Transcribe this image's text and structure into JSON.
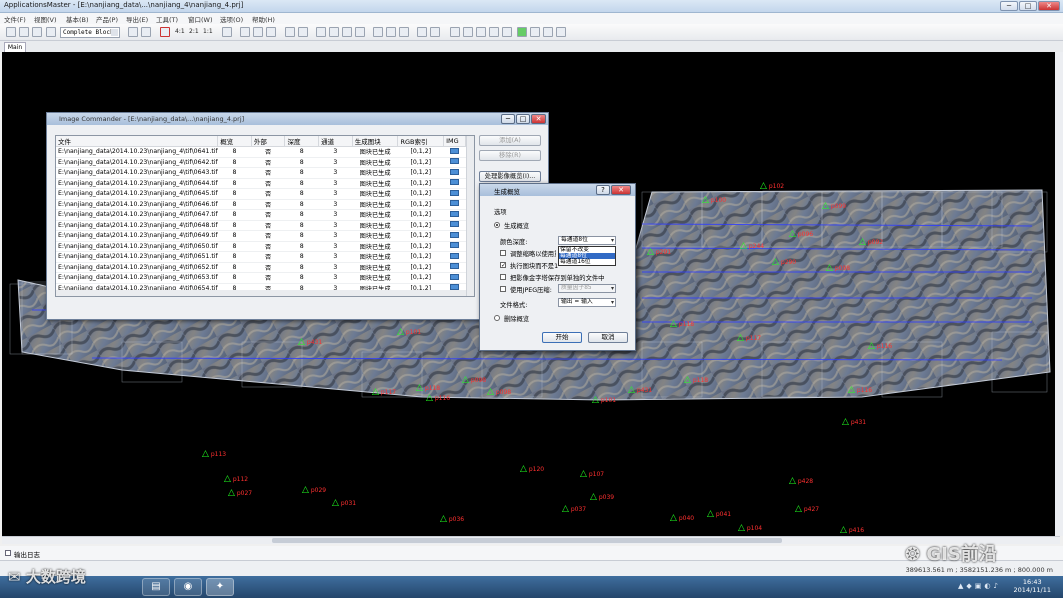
{
  "app": {
    "title": "ApplicationsMaster - [E:\\nanjiang_data\\...\\nanjiang_4\\nanjiang_4.prj]",
    "min_symbol": "─",
    "max_symbol": "□",
    "close_symbol": "✕"
  },
  "menu": [
    "文件(F)",
    "视图(V)",
    "基本(B)",
    "产品(P)",
    "导出(E)",
    "工具(T)",
    "窗口(W)",
    "选项(O)",
    "帮助(H)"
  ],
  "toolbar": {
    "block_combo": "Complete Block",
    "ratio_labels": [
      "4:1",
      "2:1",
      "1:1"
    ]
  },
  "tabs": [
    "Main"
  ],
  "map": {
    "points": [
      "p115",
      "p113",
      "p112",
      "p027",
      "p029",
      "p031",
      "p036",
      "p120",
      "p107",
      "p039",
      "p037",
      "p040",
      "p041",
      "p104",
      "p428",
      "p427",
      "p416",
      "p431",
      "p101",
      "p116",
      "p117",
      "p118",
      "p098",
      "p290",
      "p291",
      "p092",
      "p096",
      "p244",
      "p240",
      "p099",
      "p100",
      "p102"
    ]
  },
  "image_commander": {
    "title": "Image Commander - [E:\\nanjiang_data\\...\\nanjiang_4.prj]",
    "columns": [
      "文件",
      "概览",
      "外部",
      "深度",
      "通道",
      "生成图块",
      "RGB索引",
      "IMG"
    ],
    "rows": [
      [
        "E:\\nanjiang_data\\2014.10.23\\nanjiang_4\\tif\\0641.tif",
        "8",
        "否",
        "8",
        "3",
        "图块已生成",
        "[0,1,2]"
      ],
      [
        "E:\\nanjiang_data\\2014.10.23\\nanjiang_4\\tif\\0642.tif",
        "8",
        "否",
        "8",
        "3",
        "图块已生成",
        "[0,1,2]"
      ],
      [
        "E:\\nanjiang_data\\2014.10.23\\nanjiang_4\\tif\\0643.tif",
        "8",
        "否",
        "8",
        "3",
        "图块已生成",
        "[0,1,2]"
      ],
      [
        "E:\\nanjiang_data\\2014.10.23\\nanjiang_4\\tif\\0644.tif",
        "8",
        "否",
        "8",
        "3",
        "图块已生成",
        "[0,1,2]"
      ],
      [
        "E:\\nanjiang_data\\2014.10.23\\nanjiang_4\\tif\\0645.tif",
        "8",
        "否",
        "8",
        "3",
        "图块已生成",
        "[0,1,2]"
      ],
      [
        "E:\\nanjiang_data\\2014.10.23\\nanjiang_4\\tif\\0646.tif",
        "8",
        "否",
        "8",
        "3",
        "图块已生成",
        "[0,1,2]"
      ],
      [
        "E:\\nanjiang_data\\2014.10.23\\nanjiang_4\\tif\\0647.tif",
        "8",
        "否",
        "8",
        "3",
        "图块已生成",
        "[0,1,2]"
      ],
      [
        "E:\\nanjiang_data\\2014.10.23\\nanjiang_4\\tif\\0648.tif",
        "8",
        "否",
        "8",
        "3",
        "图块已生成",
        "[0,1,2]"
      ],
      [
        "E:\\nanjiang_data\\2014.10.23\\nanjiang_4\\tif\\0649.tif",
        "8",
        "否",
        "8",
        "3",
        "图块已生成",
        "[0,1,2]"
      ],
      [
        "E:\\nanjiang_data\\2014.10.23\\nanjiang_4\\tif\\0650.tif",
        "8",
        "否",
        "8",
        "3",
        "图块已生成",
        "[0,1,2]"
      ],
      [
        "E:\\nanjiang_data\\2014.10.23\\nanjiang_4\\tif\\0651.tif",
        "8",
        "否",
        "8",
        "3",
        "图块已生成",
        "[0,1,2]"
      ],
      [
        "E:\\nanjiang_data\\2014.10.23\\nanjiang_4\\tif\\0652.tif",
        "8",
        "否",
        "8",
        "3",
        "图块已生成",
        "[0,1,2]"
      ],
      [
        "E:\\nanjiang_data\\2014.10.23\\nanjiang_4\\tif\\0653.tif",
        "8",
        "否",
        "8",
        "3",
        "图块已生成",
        "[0,1,2]"
      ],
      [
        "E:\\nanjiang_data\\2014.10.23\\nanjiang_4\\tif\\0654.tif",
        "8",
        "否",
        "8",
        "3",
        "图块已生成",
        "[0,1,2]"
      ]
    ],
    "buttons": {
      "add": "添加(A)",
      "remove": "移除(R)",
      "process": "处理影像概览(I)..."
    }
  },
  "gen_dialog": {
    "title": "生成概览",
    "help_symbol": "?",
    "close_symbol": "✕",
    "options_label": "选项",
    "radio_generate": "生成概览",
    "color_depth_label": "颜色深度:",
    "color_depth_value": "每通道8位",
    "dropdown_options": [
      "保留不改变",
      "每通道8位",
      "每通道16位"
    ],
    "check_resample": "调整缩略以使用重采样",
    "check_resample_value": false,
    "check_generate_missing": "执行图块而不是1位平台",
    "check_generate_missing_value": true,
    "check_save_separate": "把影像金字塔保存到单独的文件中",
    "check_save_separate_value": false,
    "check_jpeg": "使用JPEG压缩:",
    "check_jpeg_value": false,
    "jpeg_quality": "质量因子85",
    "file_format_label": "文件格式:",
    "file_format_value": "输出 = 输入",
    "radio_delete": "删除概览",
    "ok_button": "开始",
    "cancel_button": "取消"
  },
  "log_panel": {
    "label": "输出日志"
  },
  "status": {
    "coords": "389613.561 m ; 3582151.236 m ; 800.000 m"
  },
  "taskbar": {
    "time": "16:43",
    "date": "2014/11/11"
  },
  "watermarks": {
    "left": "大数跨境",
    "right": "GIS前沿"
  }
}
